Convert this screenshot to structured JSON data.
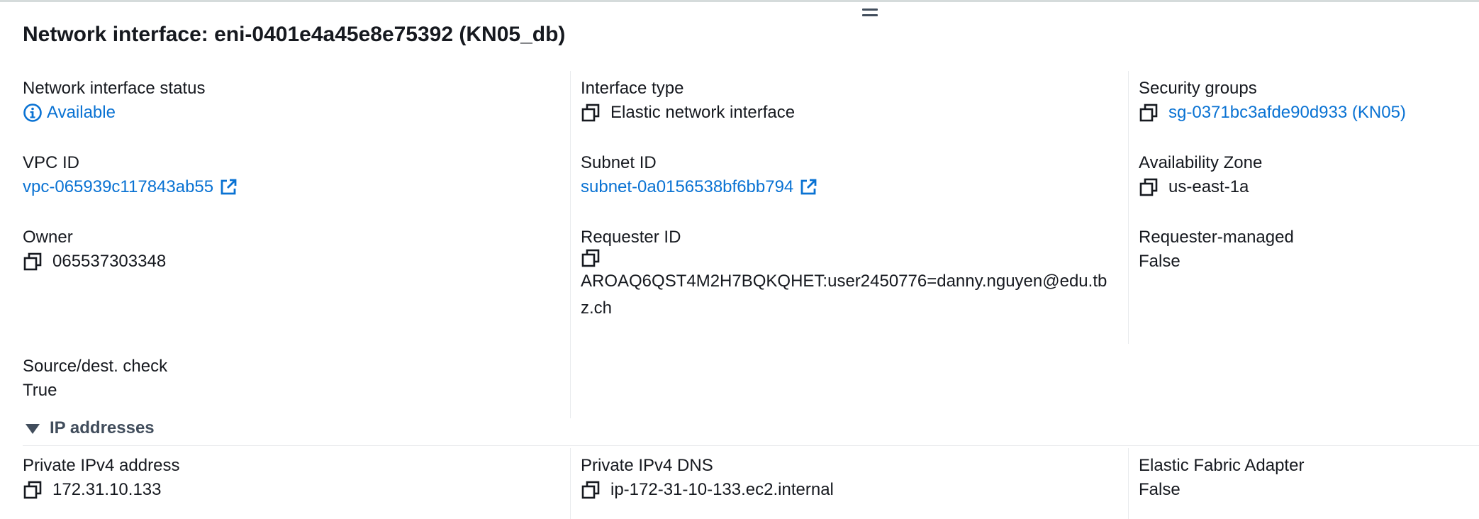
{
  "panel": {
    "title": "Network interface: eni-0401e4a45e8e75392 (KN05_db)"
  },
  "details": {
    "status": {
      "label": "Network interface status",
      "value": "Available"
    },
    "interface_type": {
      "label": "Interface type",
      "value": "Elastic network interface"
    },
    "security_groups": {
      "label": "Security groups",
      "value": "sg-0371bc3afde90d933 (KN05)"
    },
    "vpc_id": {
      "label": "VPC ID",
      "value": "vpc-065939c117843ab55"
    },
    "subnet_id": {
      "label": "Subnet ID",
      "value": "subnet-0a0156538bf6bb794"
    },
    "availability_zone": {
      "label": "Availability Zone",
      "value": "us-east-1a"
    },
    "owner": {
      "label": "Owner",
      "value": "065537303348"
    },
    "requester_id": {
      "label": "Requester ID",
      "value": "AROAQ6QST4M2H7BQKQHET:user2450776=danny.nguyen@edu.tbz.ch"
    },
    "requester_managed": {
      "label": "Requester-managed",
      "value": "False"
    },
    "source_dest_check": {
      "label": "Source/dest. check",
      "value": "True"
    }
  },
  "ip_section": {
    "title": "IP addresses",
    "expanded": true,
    "private_ipv4_address": {
      "label": "Private IPv4 address",
      "value": "172.31.10.133"
    },
    "private_ipv4_dns": {
      "label": "Private IPv4 DNS",
      "value": "ip-172-31-10-133.ec2.internal"
    },
    "elastic_fabric_adapter": {
      "label": "Elastic Fabric Adapter",
      "value": "False"
    }
  },
  "colors": {
    "link": "#0972d3",
    "text": "#16191f",
    "muted": "#414d5c",
    "divider": "#e9ebed"
  },
  "icons": {
    "copy": "copy-icon",
    "external": "external-link-icon",
    "info": "info-circle-icon",
    "caret": "caret-down-icon",
    "handle": "drag-handle-icon"
  }
}
